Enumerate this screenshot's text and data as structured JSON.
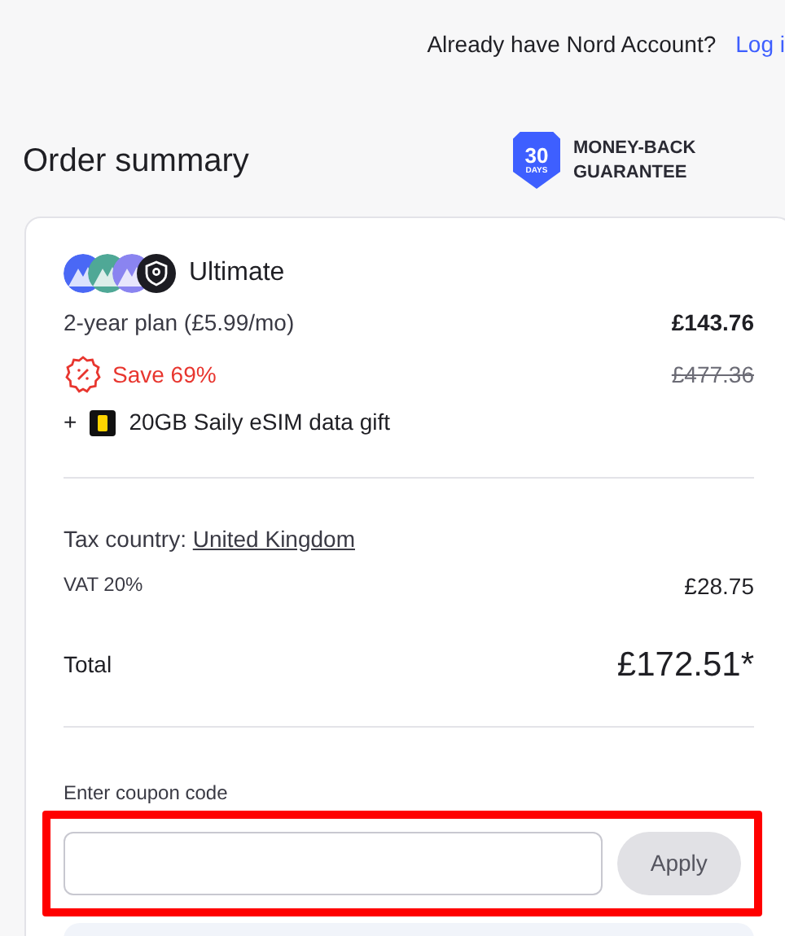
{
  "header": {
    "prompt": "Already have Nord Account?",
    "login_link": "Log i"
  },
  "title": "Order summary",
  "guarantee": {
    "days": "30",
    "unit": "DAYS",
    "text": "MONEY-BACK GUARANTEE"
  },
  "product": {
    "name": "Ultimate",
    "plan": "2-year plan (£5.99/mo)",
    "price": "£143.76",
    "discount": "Save 69%",
    "old_price": "£477.36",
    "gift_prefix": "+",
    "gift": "20GB Saily eSIM data gift"
  },
  "tax": {
    "label": "Tax country:",
    "country": "United Kingdom",
    "vat_label": "VAT 20%",
    "vat": "£28.75"
  },
  "total": {
    "label": "Total",
    "value": "£172.51*"
  },
  "coupon": {
    "label": "Enter coupon code",
    "button": "Apply",
    "highlighted": true
  }
}
